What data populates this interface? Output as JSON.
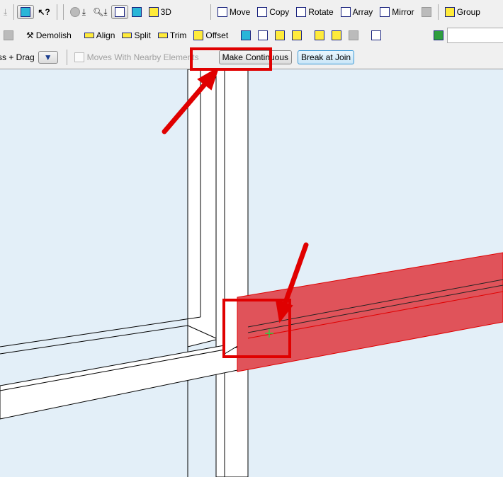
{
  "toolbar_row1": {
    "view_3d": "3D",
    "move": "Move",
    "copy": "Copy",
    "rotate": "Rotate",
    "array": "Array",
    "mirror": "Mirror",
    "group": "Group"
  },
  "toolbar_row2": {
    "demolish": "Demolish",
    "align": "Align",
    "split": "Split",
    "trim": "Trim",
    "offset": "Offset",
    "search_value": ""
  },
  "toolbar_row3": {
    "press_drag": "ss + Drag",
    "moves_with_nearby": "Moves With Nearby Elements",
    "make_continuous": "Make Continuous",
    "break_at_join": "Break at Join"
  },
  "colors": {
    "highlight": "#e00000",
    "selected_beam": "#e0535a",
    "canvas": "#e3eff8"
  }
}
